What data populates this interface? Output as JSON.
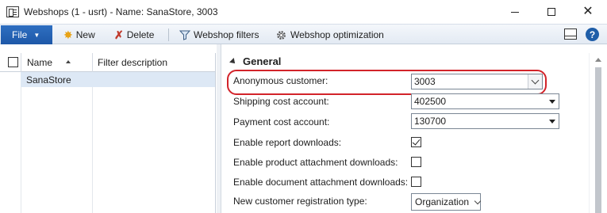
{
  "window": {
    "title": "Webshops (1 - usrt) - Name: SanaStore, 3003",
    "minimize_icon": "minimize-icon",
    "maximize_icon": "maximize-icon",
    "close_glyph": "✕"
  },
  "toolbar": {
    "file_label": "File",
    "new_label": "New",
    "delete_label": "Delete",
    "filters_label": "Webshop filters",
    "optimization_label": "Webshop optimization",
    "help_glyph": "?"
  },
  "grid": {
    "columns": [
      "Name",
      "Filter description"
    ],
    "rows": [
      {
        "name": "SanaStore",
        "filter_description": ""
      }
    ]
  },
  "details": {
    "group_title": "General",
    "fields": {
      "anonymous_customer": {
        "label": "Anonymous customer:",
        "value": "3003"
      },
      "shipping_cost_account": {
        "label": "Shipping cost account:",
        "value": "402500"
      },
      "payment_cost_account": {
        "label": "Payment cost account:",
        "value": "130700"
      },
      "enable_report_downloads": {
        "label": "Enable report downloads:",
        "checked": true
      },
      "enable_product_attachment_downloads": {
        "label": "Enable product attachment downloads:",
        "checked": false
      },
      "enable_document_attachment_downloads": {
        "label": "Enable document attachment downloads:",
        "checked": false
      },
      "new_customer_registration_type": {
        "label": "New customer registration type:",
        "value": "Organization"
      }
    }
  },
  "colors": {
    "file_button": "#2f6fc1",
    "highlight": "#d2232a",
    "selected_row": "#dde8f5",
    "help": "#1f5ea8"
  }
}
